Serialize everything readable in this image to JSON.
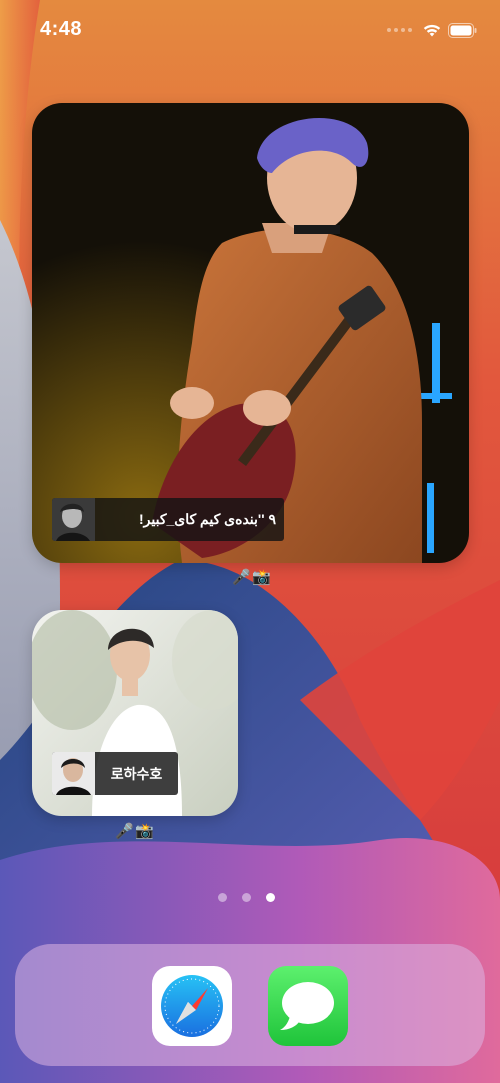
{
  "status_bar": {
    "time": "4:48"
  },
  "widgets": [
    {
      "caption": "٩ ''بندەی كیم كای_كبیر!",
      "label": "🎤📸"
    },
    {
      "caption": "로하수호",
      "label": "🎤📸"
    }
  ],
  "page_dots": {
    "count": 3,
    "active_index": 2
  },
  "dock": {
    "apps": [
      "Safari",
      "Messages"
    ]
  },
  "colors": {
    "wallpaper_red": "#d8453a",
    "wallpaper_orange": "#e98b3f",
    "wallpaper_blue": "#2b4fa0",
    "dock_tint": "#dcb4e1"
  },
  "icons": [
    "wifi-icon",
    "battery-icon",
    "safari-compass-icon",
    "messages-bubble-icon"
  ]
}
